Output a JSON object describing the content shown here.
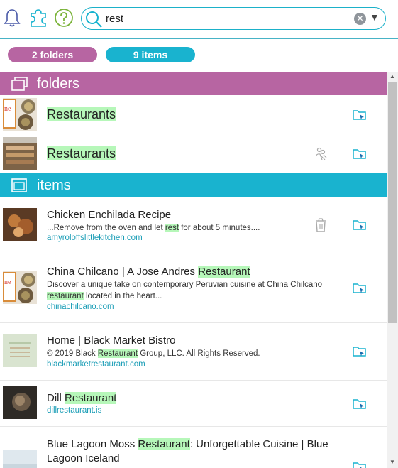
{
  "search": {
    "query": "rest"
  },
  "counts": {
    "folders": "2 folders",
    "items": "9 items"
  },
  "sections": {
    "folders": "folders",
    "items": "items"
  },
  "folders": [
    {
      "title": "Restaurants"
    },
    {
      "title": "Restaurants"
    }
  ],
  "items": [
    {
      "title_pre": "Chicken Enchilada Recipe",
      "title_hl": "",
      "title_post": "",
      "d1_pre": "...Remove from the oven and let ",
      "d1_hl": "rest",
      "d1_post": " for about 5 minutes....",
      "url": "amyroloffslittlekitchen.com"
    },
    {
      "title_pre": "China Chilcano | A Jose Andres ",
      "title_hl": "Restaurant",
      "title_post": "",
      "d1": "Discover a unique take on contemporary Peruvian cuisine at China Chilcano",
      "d2_hl": "restaurant",
      "d2_post": " located in the heart...",
      "url": "chinachilcano.com"
    },
    {
      "title_pre": "Home | Black Market Bistro",
      "title_hl": "",
      "title_post": "",
      "d1_pre": "© 2019 Black ",
      "d1_hl": "Restaurant",
      "d1_post": " Group, LLC. All Rights Reserved.",
      "url": "blackmarketrestaurant.com"
    },
    {
      "title_pre": "Dill ",
      "title_hl": "Restaurant",
      "title_post": "",
      "url": "dillrestaurant.is"
    },
    {
      "title_pre": "Blue Lagoon Moss ",
      "title_hl": "Restaurant",
      "title_post": ": Unforgettable Cuisine | Blue",
      "title_line2": "Lagoon Iceland"
    }
  ],
  "colors": {
    "accent": "#19b3cf",
    "folder": "#b765a2",
    "highlight": "#b6f7b9",
    "link": "#1a9db6"
  },
  "icons": [
    "bell-icon",
    "puzzle-icon",
    "help-icon",
    "search-icon",
    "clear-icon",
    "dropdown-icon",
    "folder-icon",
    "window-icon",
    "open-folder-icon",
    "share-icon",
    "trash-icon"
  ]
}
